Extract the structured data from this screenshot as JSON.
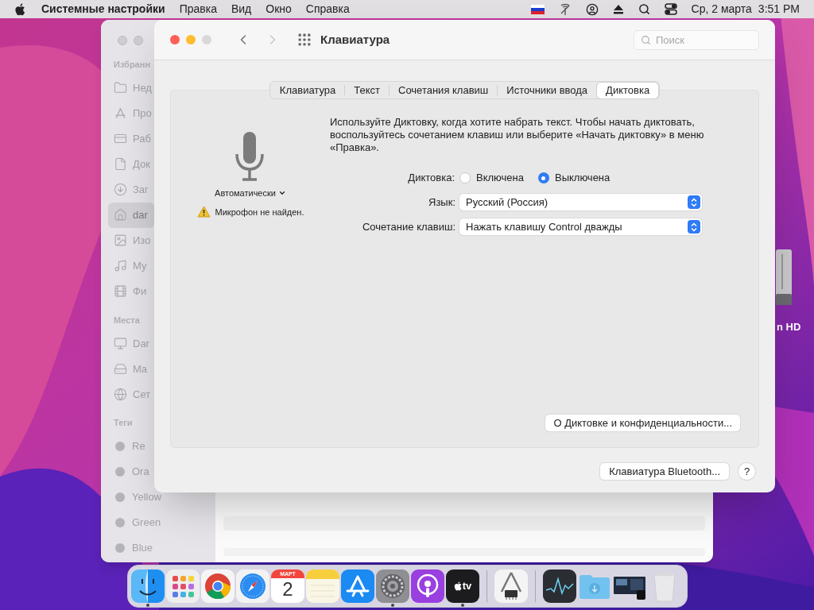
{
  "menu_bar": {
    "app_name": "Системные настройки",
    "menus": [
      "Правка",
      "Вид",
      "Окно",
      "Справка"
    ],
    "date": "Ср, 2 марта",
    "time": "3:51 PM"
  },
  "desktop_icons": [
    {
      "label": "n HD"
    }
  ],
  "finder_window": {
    "sections": [
      {
        "title": "Избранн",
        "items": [
          {
            "label": "Нед",
            "kind": "folder",
            "selected": false
          },
          {
            "label": "Про",
            "kind": "apps",
            "selected": false
          },
          {
            "label": "Раб",
            "kind": "desktop",
            "selected": false
          },
          {
            "label": "Док",
            "kind": "document",
            "selected": false
          },
          {
            "label": "Заг",
            "kind": "download",
            "selected": false
          },
          {
            "label": "dar",
            "kind": "home",
            "selected": true
          },
          {
            "label": "Изо",
            "kind": "pictures",
            "selected": false
          },
          {
            "label": "Му",
            "kind": "music",
            "selected": false
          },
          {
            "label": "Фи",
            "kind": "movies",
            "selected": false
          }
        ]
      },
      {
        "title": "Места",
        "items": [
          {
            "label": "Dar",
            "kind": "computer",
            "selected": false
          },
          {
            "label": "Ma",
            "kind": "disk",
            "selected": false
          },
          {
            "label": "Сет",
            "kind": "network",
            "selected": false
          }
        ]
      },
      {
        "title": "Теги",
        "items": [
          {
            "label": "Re",
            "kind": "tag",
            "selected": false
          },
          {
            "label": "Ora",
            "kind": "tag",
            "selected": false
          },
          {
            "label": "Yellow",
            "kind": "tag",
            "selected": false
          },
          {
            "label": "Green",
            "kind": "tag",
            "selected": false
          },
          {
            "label": "Blue",
            "kind": "tag",
            "selected": false
          }
        ]
      }
    ]
  },
  "prefs_window": {
    "title": "Клавиатура",
    "search": {
      "placeholder": "Поиск"
    },
    "tabs": [
      {
        "label": "Клавиатура",
        "selected": false
      },
      {
        "label": "Текст",
        "selected": false
      },
      {
        "label": "Сочетания клавиш",
        "selected": false
      },
      {
        "label": "Источники ввода",
        "selected": false
      },
      {
        "label": "Диктовка",
        "selected": true
      }
    ],
    "microphone": {
      "source": "Автоматически",
      "warning": "Микрофон не найден."
    },
    "description": "Используйте Диктовку, когда хотите набрать текст. Чтобы начать диктовать, воспользуйтесь сочетанием клавиш или выберите «Начать диктовку» в меню «Правка».",
    "dictation": {
      "label": "Диктовка:",
      "options": [
        {
          "label": "Включена",
          "selected": false
        },
        {
          "label": "Выключена",
          "selected": true
        }
      ]
    },
    "selects": [
      {
        "label": "Язык:",
        "value": "Русский (Россия)"
      },
      {
        "label": "Сочетание клавиш:",
        "value": "Нажать клавишу Control дважды"
      }
    ],
    "privacy_button": "О Диктовке и конфиденциальности...",
    "bluetooth_button": "Клавиатура Bluetooth...",
    "help_button": "?"
  },
  "dock": {
    "groups": [
      [
        {
          "kind": "finder",
          "running": true
        },
        {
          "kind": "launchpad",
          "running": false
        },
        {
          "kind": "chrome",
          "running": false
        },
        {
          "kind": "safari",
          "running": false
        },
        {
          "kind": "calendar",
          "running": false,
          "month": "МАРТ",
          "day": "2"
        },
        {
          "kind": "notes",
          "running": false
        },
        {
          "kind": "appstore",
          "running": false
        },
        {
          "kind": "settings",
          "running": true
        },
        {
          "kind": "podcasts",
          "running": false
        },
        {
          "kind": "tv",
          "running": true,
          "label": "tv"
        }
      ],
      [
        {
          "kind": "utility",
          "running": false
        }
      ],
      [
        {
          "kind": "activity",
          "running": false
        },
        {
          "kind": "downloads",
          "running": false
        },
        {
          "kind": "screenshot",
          "running": false
        },
        {
          "kind": "trash",
          "running": false
        }
      ]
    ]
  }
}
